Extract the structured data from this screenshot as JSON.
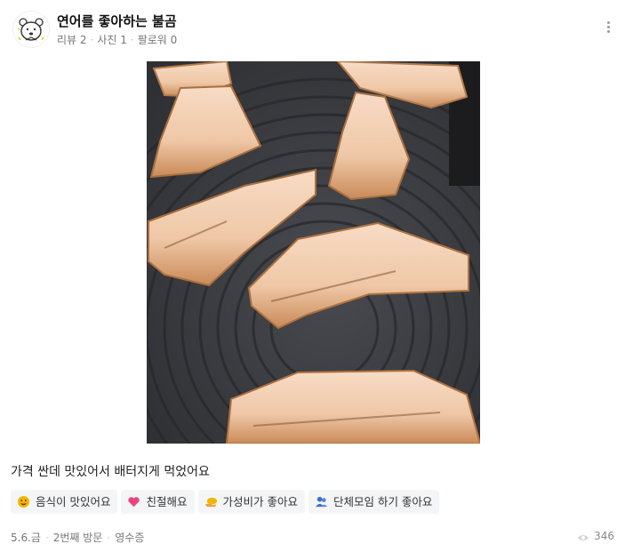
{
  "profile": {
    "name": "연어를 좋아하는 불곰",
    "stats": [
      "리뷰 2",
      "사진 1",
      "팔로워 0"
    ]
  },
  "review": {
    "text": "가격 싼데 맛있어서 배터지게 먹었어요",
    "photo_alt": "불판 위에서 구워지는 연어 조각"
  },
  "tags": [
    {
      "label": "음식이 맛있어요",
      "icon": "yum-emoji-icon",
      "color": "#f2b705"
    },
    {
      "label": "친절해요",
      "icon": "heart-icon",
      "color": "#e8467c"
    },
    {
      "label": "가성비가 좋아요",
      "icon": "coin-hand-icon",
      "color": "#f2b705"
    },
    {
      "label": "단체모임 하기 좋아요",
      "icon": "group-icon",
      "color": "#3b6fc7"
    }
  ],
  "footer": {
    "date": "5.6.금",
    "visit": "2번째 방문",
    "receipt": "영수증",
    "views": "346"
  }
}
